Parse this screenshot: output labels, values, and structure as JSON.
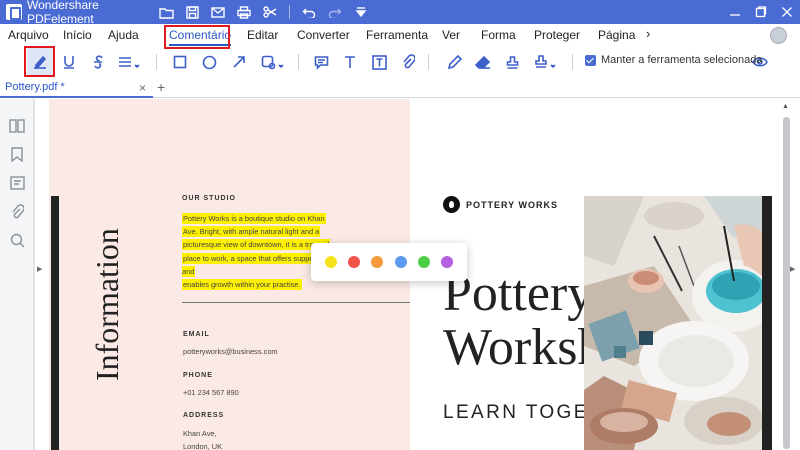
{
  "app": {
    "title": "Wondershare PDFelement"
  },
  "menu": {
    "items": [
      "Arquivo",
      "Início",
      "Ajuda",
      "Comentário",
      "Editar",
      "Converter",
      "Ferramenta",
      "Ver",
      "Forma",
      "Proteger",
      "Página"
    ],
    "active": "Comentário",
    "more": "›"
  },
  "toolbar": {
    "keep_tool_label": "Manter a ferramenta selecionada",
    "keep_tool_checked": true
  },
  "tab": {
    "filename": "Pottery.pdf *",
    "close": "×",
    "add": "+"
  },
  "document": {
    "vertical_title": "Information",
    "studio_heading": "OUR STUDIO",
    "studio_lines": [
      "Pottery Works is a boutique studio on Khan",
      "Ave. Bright, with ample natural light and a",
      "picturesque view of downtown, it is a tranquil",
      "place to work, a space that offers support and",
      "enables growth within your practise."
    ],
    "email_heading": "EMAIL",
    "email": "potteryworks@business.com",
    "phone_heading": "PHONE",
    "phone": "+01 234 567 890",
    "address_heading": "ADDRESS",
    "address_line1": "Khan Ave,",
    "address_line2": "London, UK",
    "brand": "POTTERY WORKS",
    "title_line1": "Pottery",
    "title_line2": "Workshops",
    "subtitle": "LEARN TOGETHER"
  },
  "highlight_palette": [
    "#f5e31b",
    "#f0524c",
    "#f59a3b",
    "#5b9bf0",
    "#4ccf44",
    "#b45ee0"
  ],
  "colors": {
    "accent": "#4a6bd3",
    "highlight": "#fdf000",
    "callout_red": "#e0191f"
  }
}
